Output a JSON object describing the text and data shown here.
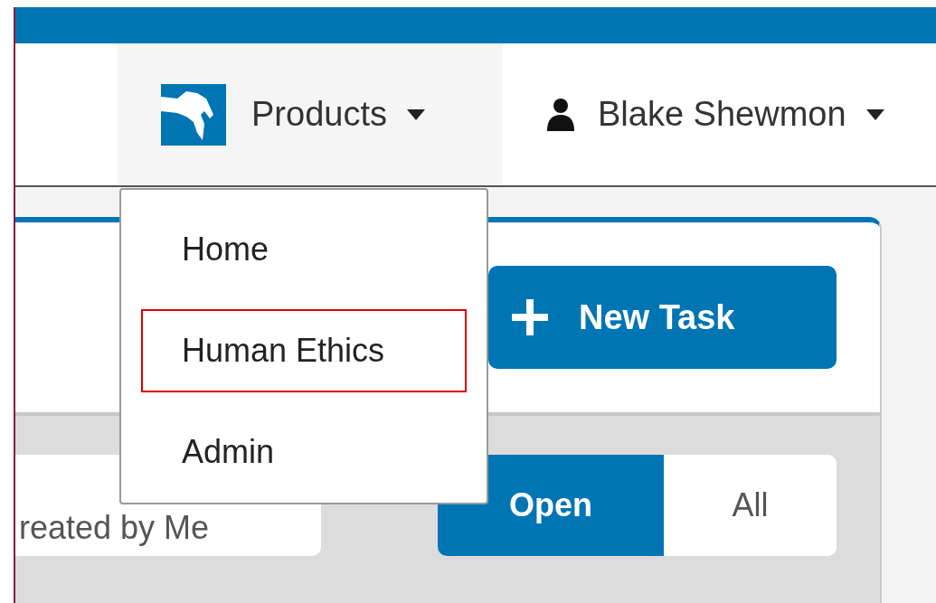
{
  "top_nav": {
    "products_menu": {
      "label": "Products",
      "expanded": true
    },
    "user_menu": {
      "label": "Blake Shewmon"
    }
  },
  "dropdown": {
    "items": [
      {
        "label": "Home",
        "selected": false
      },
      {
        "label": "Human Ethics",
        "selected": true
      },
      {
        "label": "Admin",
        "selected": false
      }
    ]
  },
  "new_task_button": {
    "label": "New Task"
  },
  "filters": {
    "scope": {
      "label": "reated by Me"
    },
    "status_toggle": [
      {
        "label": "Open",
        "selected": true
      },
      {
        "label": "All",
        "selected": false
      }
    ]
  }
}
